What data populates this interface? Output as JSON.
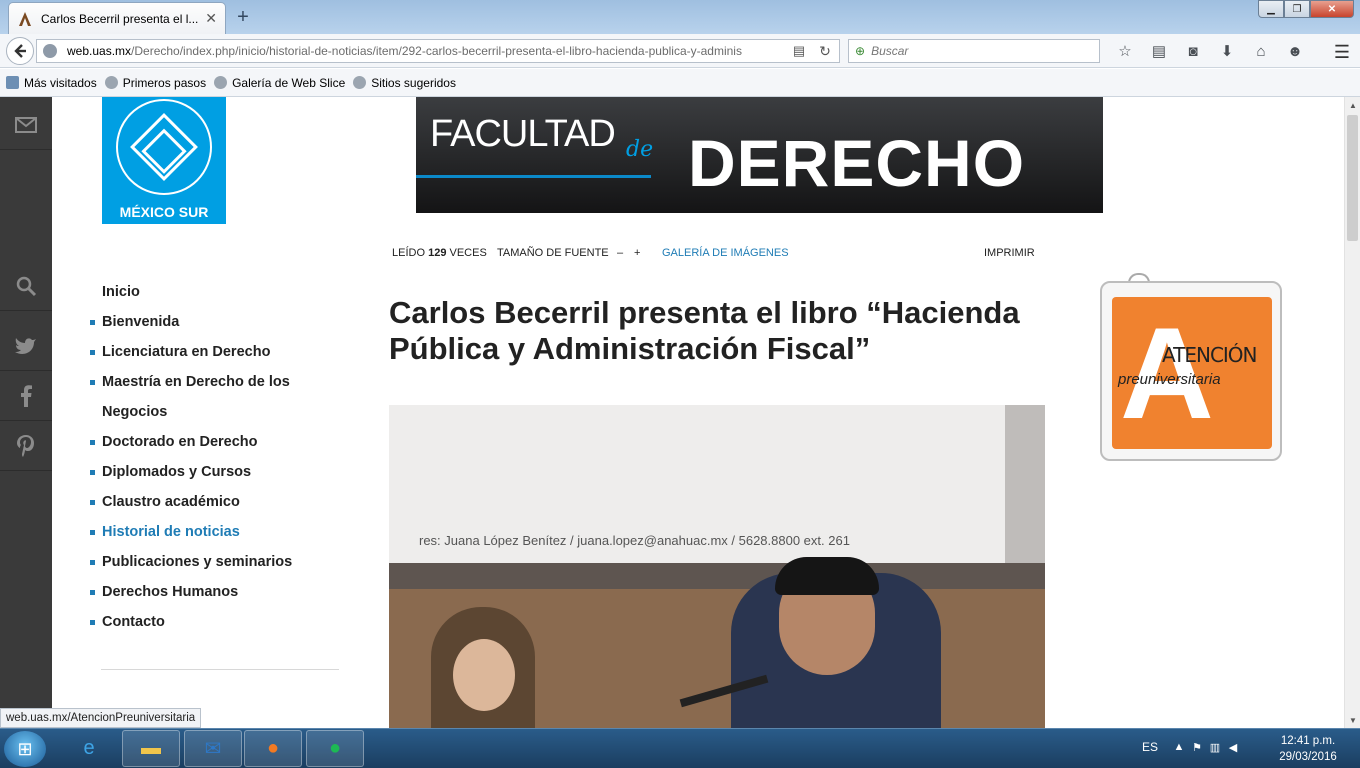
{
  "browser": {
    "tab_title": "Carlos Becerril presenta el l...",
    "tab_close": "✕",
    "new_tab": "+",
    "url_host": "web.uas.mx",
    "url_path": "/Derecho/index.php/inicio/historial-de-noticias/item/292-carlos-becerril-presenta-el-libro-hacienda-publica-y-adminis",
    "search_placeholder": "Buscar",
    "bookmarks": [
      "Más visitados",
      "Primeros pasos",
      "Galería de Web Slice",
      "Sitios sugeridos"
    ]
  },
  "site": {
    "logo_text": "MÉXICO SUR",
    "banner_left": "FACULTAD",
    "banner_de": "de",
    "banner_right": "DERECHO"
  },
  "article_toolbar": {
    "read_prefix": "LEÍDO",
    "read_count": "129",
    "read_suffix": "VECES",
    "font_size_label": "TAMAÑO DE FUENTE",
    "decrease": "–",
    "increase": "+",
    "gallery": "GALERÍA DE IMÁGENES",
    "print": "IMPRIMIR"
  },
  "menu": {
    "items": [
      {
        "label": "Inicio"
      },
      {
        "label": "Bienvenida"
      },
      {
        "label": "Licenciatura en Derecho"
      },
      {
        "label": "Maestría en Derecho de los"
      },
      {
        "label": "Negocios"
      },
      {
        "label": "Doctorado en Derecho"
      },
      {
        "label": "Diplomados y Cursos"
      },
      {
        "label": "Claustro académico"
      },
      {
        "label": "Historial de noticias"
      },
      {
        "label": "Publicaciones y seminarios"
      },
      {
        "label": "Derechos Humanos"
      },
      {
        "label": "Contacto"
      }
    ]
  },
  "article": {
    "title": "Carlos Becerril presenta el libro “Hacienda Pública y Administración Fiscal”",
    "photo_caption": "res: Juana López Benítez / juana.lopez@anahuac.mx / 5628.8800 ext. 261"
  },
  "ad": {
    "word1": "ATENCIÓN",
    "word2": "preuniversitaria"
  },
  "status_url": "web.uas.mx/AtencionPreuniversitaria",
  "taskbar": {
    "language": "ES",
    "time": "12:41 p.m.",
    "date": "29/03/2016"
  },
  "colors": {
    "accent_blue": "#1f7cb5",
    "brand_cyan": "#009fe3",
    "ad_orange": "#f0822f"
  }
}
